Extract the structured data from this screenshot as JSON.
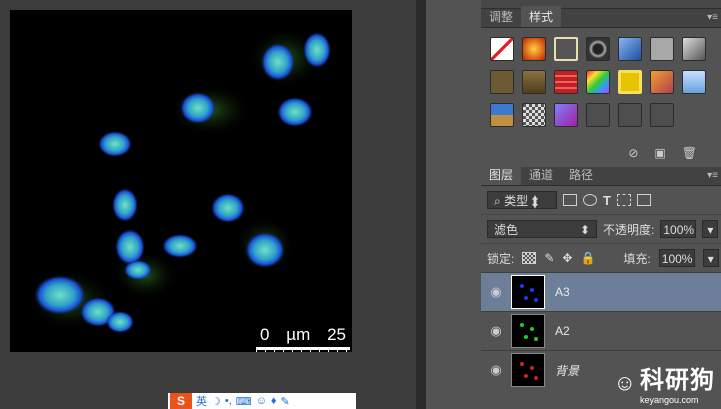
{
  "scalebar": {
    "left": "0",
    "unit": "µm",
    "right": "25"
  },
  "ime": {
    "lang": "英"
  },
  "styles_panel": {
    "tabs": [
      "调整",
      "样式"
    ]
  },
  "layers_panel": {
    "tabs": [
      "图层",
      "通道",
      "路径"
    ],
    "filter_kind": "类型",
    "blend_mode": "滤色",
    "opacity_label": "不透明度:",
    "opacity_value": "100%",
    "lock_label": "锁定:",
    "fill_label": "填充:",
    "fill_value": "100%",
    "layers": [
      {
        "name": "A3",
        "selected": true
      },
      {
        "name": "A2",
        "selected": false
      },
      {
        "name": "背景",
        "selected": false
      }
    ]
  },
  "logo": {
    "name": "科研狗",
    "url": "keyangou.com"
  }
}
